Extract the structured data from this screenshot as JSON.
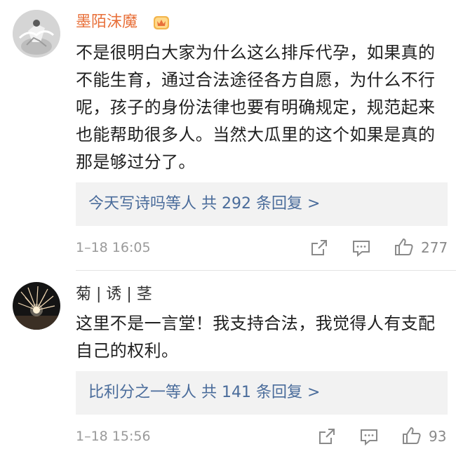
{
  "colors": {
    "vip_username": "#e8703a",
    "username": "#333333",
    "reply_link": "#4a6c9b",
    "meta": "#9a9a9a",
    "reply_box_bg": "#f2f2f2"
  },
  "comments": [
    {
      "username": "墨陌沫魔",
      "badge_icon": "vip-crown-icon",
      "avatar_icon": "user-avatar-figure",
      "text": "不是很明白大家为什么这么排斥代孕，如果真的不能生育，通过合法途径各方自愿，为什么不行呢，孩子的身份法律也要有明确规定，规范起来也能帮助很多人。当然大瓜里的这个如果是真的那是够过分了。",
      "replies_link": "今天写诗吗等人  共 292 条回复 >",
      "timestamp": "1–18 16:05",
      "likes": "277",
      "action_icons": [
        "share-icon",
        "comment-icon",
        "like-icon"
      ]
    },
    {
      "username": "菊 | 诱 | 茎",
      "avatar_icon": "user-avatar-fireworks",
      "text": "这里不是一言堂！我支持合法，我觉得人有支配自己的权利。",
      "replies_link": "比利分之一等人  共 141 条回复 >",
      "timestamp": "1–18 15:56",
      "likes": "93",
      "action_icons": [
        "share-icon",
        "comment-icon",
        "like-icon"
      ]
    }
  ]
}
